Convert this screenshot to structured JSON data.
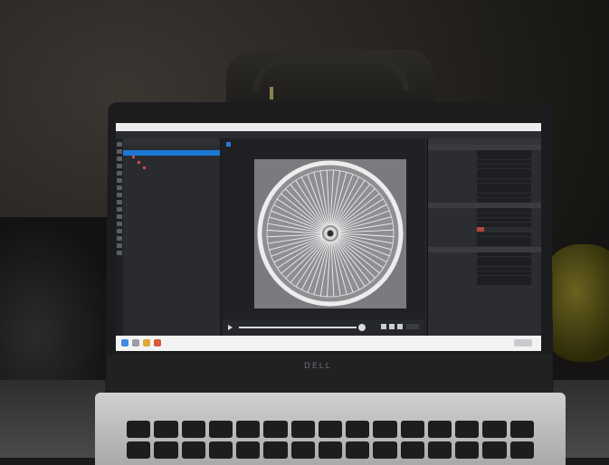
{
  "scene": {
    "laptop_brand": "DELL"
  },
  "app": {
    "menu": [
      "",
      "",
      "",
      "",
      "",
      "",
      "",
      "",
      "",
      ""
    ],
    "tree": {
      "header": "",
      "rows": [
        {
          "label": "",
          "right": ""
        },
        {
          "label": "",
          "right": ""
        },
        {
          "label": "",
          "right": ""
        },
        {
          "label": "",
          "right": ""
        },
        {
          "label": "",
          "right": ""
        }
      ]
    },
    "properties": {
      "header": "",
      "sections": [
        "",
        "",
        ""
      ]
    }
  },
  "colors": {
    "accent": "#1b78d4",
    "viewport_bg": "#7a7b7e",
    "wheel_stroke": "#e9e9ea",
    "taskbar": "#f3f3f4"
  },
  "icons": [
    "search-icon",
    "folder-icon",
    "browser-icon",
    "play-icon",
    "zoom-icon",
    "settings-icon"
  ]
}
